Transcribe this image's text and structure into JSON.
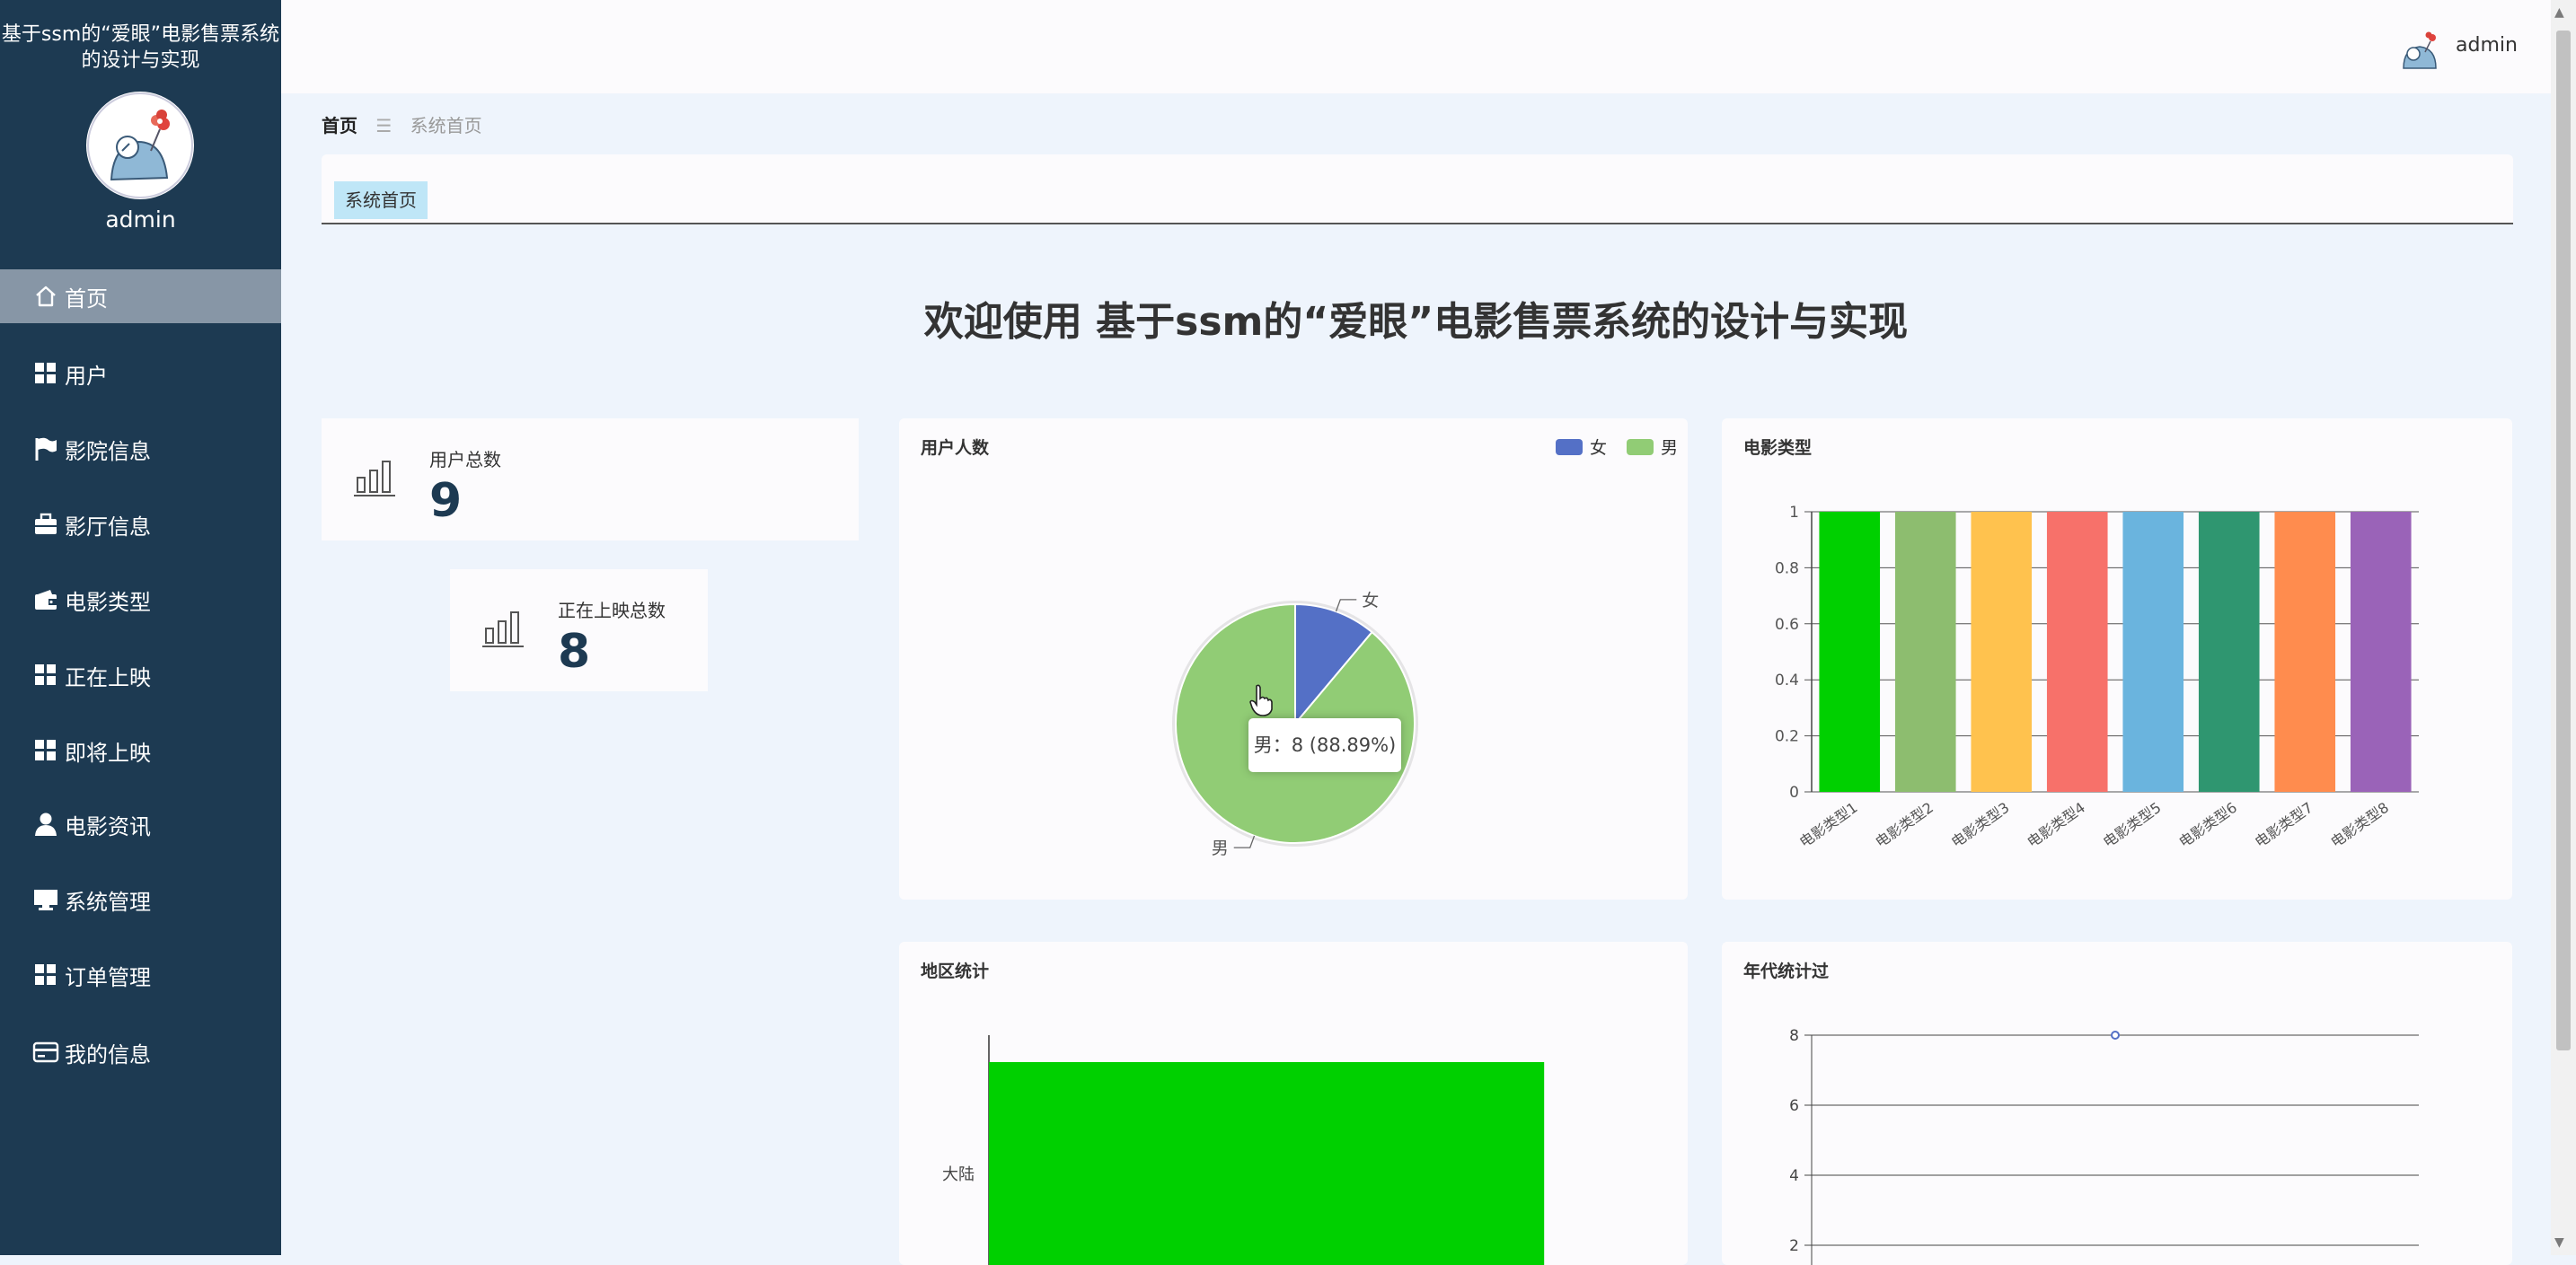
{
  "app": {
    "title": "基于ssm的“爱眼”电影售票系统的设计与实现",
    "welcome_prefix": "欢迎使用",
    "user": "admin"
  },
  "sidebar": {
    "items": [
      {
        "label": "首页",
        "icon": "home-icon",
        "active": true
      },
      {
        "label": "用户",
        "icon": "grid-icon"
      },
      {
        "label": "影院信息",
        "icon": "flag-icon"
      },
      {
        "label": "影厅信息",
        "icon": "briefcase-icon"
      },
      {
        "label": "电影类型",
        "icon": "wallet-icon"
      },
      {
        "label": "正在上映",
        "icon": "grid-icon"
      },
      {
        "label": "即将上映",
        "icon": "grid-icon"
      },
      {
        "label": "电影资讯",
        "icon": "person-icon"
      },
      {
        "label": "系统管理",
        "icon": "monitor-icon"
      },
      {
        "label": "订单管理",
        "icon": "grid-icon"
      },
      {
        "label": "我的信息",
        "icon": "card-icon"
      }
    ]
  },
  "breadcrumb": {
    "home": "首页",
    "separator": "☰",
    "current": "系统首页"
  },
  "tabs": [
    {
      "label": "系统首页"
    }
  ],
  "stats": [
    {
      "label": "用户总数",
      "value": "9"
    },
    {
      "label": "正在上映总数",
      "value": "8"
    }
  ],
  "charts": {
    "gender": {
      "title": "用户人数",
      "tooltip": "男：8 (88.89%)"
    },
    "movie_type": {
      "title": "电影类型"
    },
    "region": {
      "title": "地区统计"
    },
    "year": {
      "title": "年代统计过"
    }
  },
  "colors": {
    "sidebar": "#1d3a52",
    "active_menu": "#8796a6",
    "female": "#5470c6",
    "male": "#91cc75",
    "bars": [
      "#00d000",
      "#8dbd6f",
      "#ffc24e",
      "#f7716a",
      "#6ab4de",
      "#2f9670",
      "#ff8c4e",
      "#9a63b8"
    ],
    "region_bar": "#00d000"
  },
  "chart_data": [
    {
      "type": "pie",
      "title": "用户人数",
      "categories": [
        "女",
        "男"
      ],
      "values": [
        1,
        8
      ],
      "legend": "top-right"
    },
    {
      "type": "bar",
      "title": "电影类型",
      "categories": [
        "电影类型1",
        "电影类型2",
        "电影类型3",
        "电影类型4",
        "电影类型5",
        "电影类型6",
        "电影类型7",
        "电影类型8"
      ],
      "values": [
        1,
        1,
        1,
        1,
        1,
        1,
        1,
        1
      ],
      "ylim": [
        0,
        1
      ],
      "yticks": [
        "0",
        "0.2",
        "0.4",
        "0.6",
        "0.8",
        "1"
      ],
      "grid": true
    },
    {
      "type": "bar",
      "orientation": "horizontal",
      "title": "地区统计",
      "categories": [
        "大陆"
      ],
      "values": [
        8
      ]
    },
    {
      "type": "line",
      "title": "年代统计过",
      "values": [
        8
      ],
      "yticks": [
        "2",
        "4",
        "6",
        "8"
      ],
      "grid": true
    }
  ]
}
